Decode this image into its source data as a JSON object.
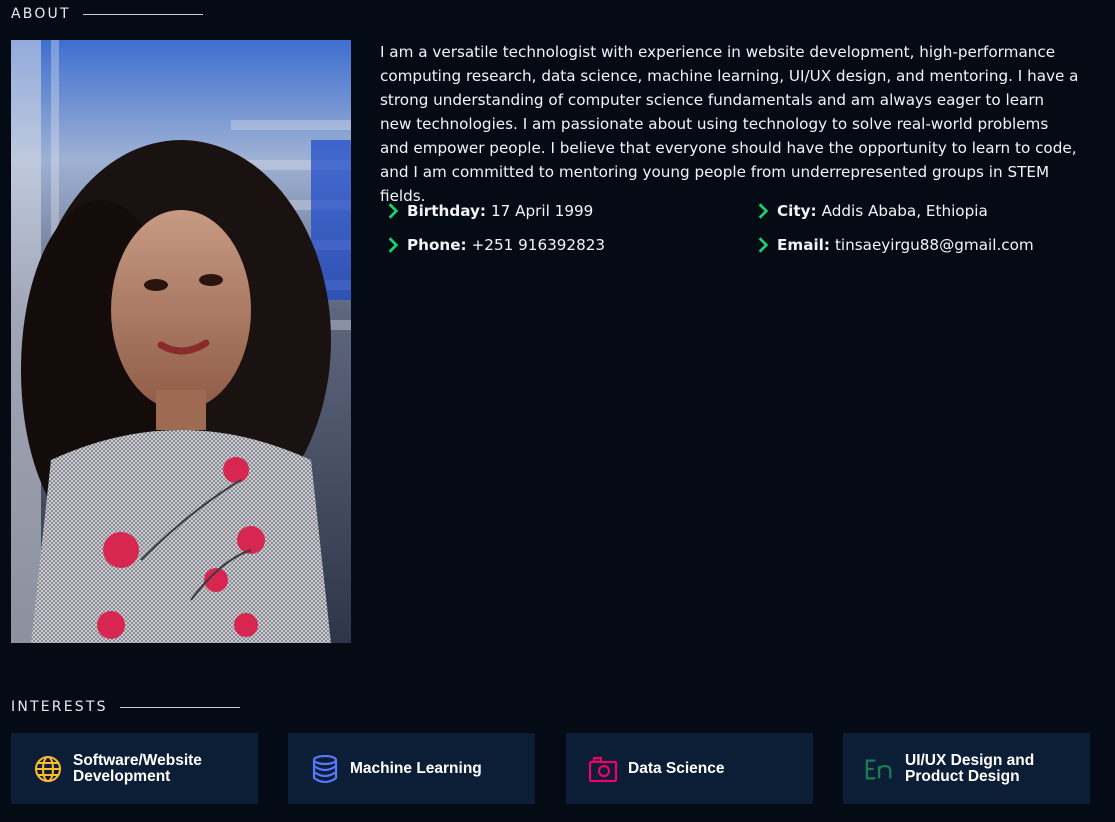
{
  "about": {
    "title": "ABOUT",
    "photo_alt": "Profile photo",
    "bio": "I am a versatile technologist with experience in website development, high-performance computing research, data science, machine learning, UI/UX design, and mentoring. I have a strong understanding of computer science fundamentals and am always eager to learn new technologies. I am passionate about using technology to solve real-world problems and empower people. I believe that everyone should have the opportunity to learn to code, and I am committed to mentoring young people from underrepresented groups in STEM fields.",
    "facts": {
      "birthday": {
        "label": "Birthday:",
        "value": "17 April 1999"
      },
      "phone": {
        "label": "Phone:",
        "value": "+251 916392823"
      },
      "city": {
        "label": "City:",
        "value": "Addis Ababa, Ethiopia"
      },
      "email": {
        "label": "Email:",
        "value": "tinsaeyirgu88@gmail.com"
      }
    },
    "chevron_icon": "chevron-right-icon"
  },
  "interests": {
    "title": "INTERESTS",
    "cards": [
      {
        "label": "Software/Website Development",
        "icon": "globe-icon",
        "color": "#ffbb2c"
      },
      {
        "label": "Machine Learning",
        "icon": "database-icon",
        "color": "#5578ff"
      },
      {
        "label": "Data Science",
        "icon": "camera-icon",
        "color": "#e80368"
      },
      {
        "label": "UI/UX Design and Product Design",
        "icon": "translate-icon",
        "color": "#1c7c54"
      }
    ]
  },
  "colors": {
    "background": "#040b14",
    "card": "#0c1e36",
    "accent": "#149ddd",
    "chevron": "#18d26e"
  }
}
